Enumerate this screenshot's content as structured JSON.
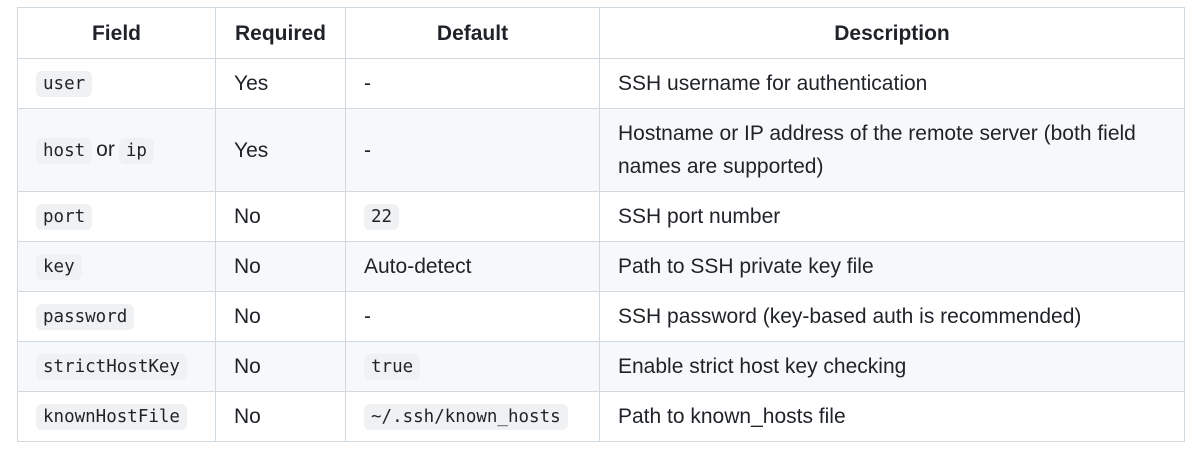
{
  "table": {
    "headers": {
      "field": "Field",
      "required": "Required",
      "default": "Default",
      "description": "Description"
    },
    "rows": [
      {
        "field": "user",
        "required": "Yes",
        "default": "-",
        "description": "SSH username for authentication"
      },
      {
        "field": "host",
        "field_joiner": "or",
        "field_alt": "ip",
        "required": "Yes",
        "default": "-",
        "description": "Hostname or IP address of the remote server (both field names are supported)"
      },
      {
        "field": "port",
        "required": "No",
        "default": "22",
        "default_is_code": true,
        "description": "SSH port number"
      },
      {
        "field": "key",
        "required": "No",
        "default": "Auto-detect",
        "description": "Path to SSH private key file"
      },
      {
        "field": "password",
        "required": "No",
        "default": "-",
        "description": "SSH password (key-based auth is recommended)"
      },
      {
        "field": "strictHostKey",
        "required": "No",
        "default": "true",
        "default_is_code": true,
        "description": "Enable strict host key checking"
      },
      {
        "field": "knownHostFile",
        "required": "No",
        "default": "~/.ssh/known_hosts",
        "default_is_code": true,
        "description": "Path to known_hosts file"
      }
    ]
  }
}
